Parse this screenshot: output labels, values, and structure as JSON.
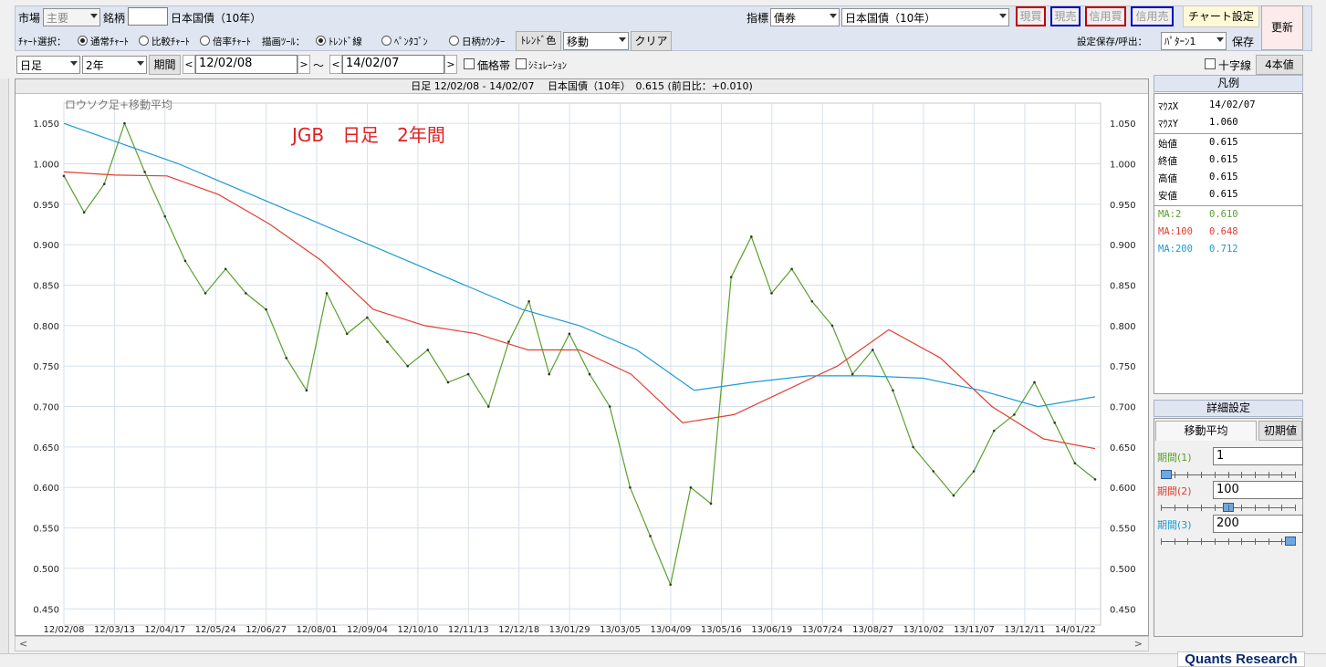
{
  "toolbar": {
    "market_label": "市場",
    "market_value": "主要",
    "issue_label": "銘柄",
    "issue_code": "",
    "issue_name": "日本国債（10年）",
    "indicator_label": "指標",
    "indicator_value": "債券",
    "indicator_name": "日本国債（10年）",
    "buttons": [
      "現買",
      "現売",
      "信用買",
      "信用売"
    ],
    "chart_settings": "チャート設定",
    "refresh": "更新",
    "chart_select_label": "ﾁｬｰﾄ選択：",
    "chart_types": [
      "通常ﾁｬｰﾄ",
      "比較ﾁｬｰﾄ",
      "倍率ﾁｬｰﾄ"
    ],
    "draw_tool_label": "描画ﾂｰﾙ：",
    "draw_tools": [
      "ﾄﾚﾝﾄﾞ線",
      "ﾍﾟﾝﾀｺﾞﾝ",
      "日柄ｶｳﾝﾀｰ"
    ],
    "trend_color": "ﾄﾚﾝﾄﾞ色",
    "move_value": "移動",
    "clear": "クリア",
    "save_load_label": "設定保存/呼出：",
    "pattern_value": "ﾊﾟﾀｰﾝ1",
    "save": "保存",
    "period_type": "日足",
    "period_range": "2年",
    "period_btn": "期間",
    "date_from": "12/02/08",
    "tilde": "～",
    "date_to": "14/02/07",
    "price_band": "価格帯",
    "simulation": "ｼﾐｭﾚｰｼｮﾝ",
    "crosshair": "十字線",
    "four_values": "4本値"
  },
  "chart": {
    "header": "日足 12/02/08 - 14/02/07　 日本国債（10年）　0.615 (前日比：+0.010)",
    "subtitle": "ロウソク足+移動平均",
    "annotation": "JGB　日足　2年間"
  },
  "chart_data": {
    "type": "line",
    "ylim": [
      0.43,
      1.075
    ],
    "y_ticks": [
      "1.050",
      "1.000",
      "0.950",
      "0.900",
      "0.850",
      "0.800",
      "0.750",
      "0.700",
      "0.650",
      "0.600",
      "0.550",
      "0.500",
      "0.450"
    ],
    "x_ticks": [
      "12/02/08",
      "12/03/13",
      "12/04/17",
      "12/05/24",
      "12/06/27",
      "12/08/01",
      "12/09/04",
      "12/10/10",
      "12/11/13",
      "12/12/18",
      "13/01/29",
      "13/03/05",
      "13/04/09",
      "13/05/16",
      "13/06/19",
      "13/07/24",
      "13/08/27",
      "13/10/02",
      "13/11/07",
      "13/12/11",
      "14/01/22"
    ],
    "series": [
      {
        "name": "MA:2",
        "color": "#5aa02c",
        "values": [
          0.985,
          0.94,
          0.975,
          1.05,
          0.99,
          0.935,
          0.88,
          0.84,
          0.87,
          0.84,
          0.82,
          0.76,
          0.72,
          0.84,
          0.79,
          0.81,
          0.78,
          0.75,
          0.77,
          0.73,
          0.74,
          0.7,
          0.78,
          0.83,
          0.74,
          0.79,
          0.74,
          0.7,
          0.6,
          0.54,
          0.48,
          0.6,
          0.58,
          0.86,
          0.91,
          0.84,
          0.87,
          0.83,
          0.8,
          0.74,
          0.77,
          0.72,
          0.65,
          0.62,
          0.59,
          0.62,
          0.67,
          0.69,
          0.73,
          0.68,
          0.63,
          0.61
        ]
      },
      {
        "name": "MA:100",
        "color": "#e04030",
        "values": [
          0.99,
          0.986,
          0.985,
          0.962,
          0.925,
          0.88,
          0.82,
          0.8,
          0.79,
          0.77,
          0.77,
          0.74,
          0.68,
          0.69,
          0.72,
          0.75,
          0.795,
          0.76,
          0.7,
          0.66,
          0.648
        ]
      },
      {
        "name": "MA:200",
        "color": "#1e9ad6",
        "values": [
          1.05,
          1.025,
          1.0,
          0.97,
          0.94,
          0.91,
          0.88,
          0.85,
          0.82,
          0.8,
          0.77,
          0.72,
          0.73,
          0.738,
          0.738,
          0.735,
          0.72,
          0.7,
          0.712
        ]
      }
    ]
  },
  "legend": {
    "title": "凡例",
    "mouse_x_label": "ﾏｳｽX",
    "mouse_x": "14/02/07",
    "mouse_y_label": "ﾏｳｽY",
    "mouse_y": "1.060",
    "open_label": "始値",
    "open": "0.615",
    "close_label": "終値",
    "close": "0.615",
    "high_label": "高値",
    "high": "0.615",
    "low_label": "安値",
    "low": "0.615",
    "ma2_label": "MA:2",
    "ma2": "0.610",
    "ma100_label": "MA:100",
    "ma100": "0.648",
    "ma200_label": "MA:200",
    "ma200": "0.712"
  },
  "detail": {
    "title": "詳細設定",
    "tab_ma": "移動平均",
    "init": "初期値",
    "p1_label": "期間(1)",
    "p1": "1",
    "p2_label": "期間(2)",
    "p2": "100",
    "p3_label": "期間(3)",
    "p3": "200",
    "slider1": 0.0,
    "slider2": 0.5,
    "slider3": 1.0
  },
  "brand": "Quants Research"
}
